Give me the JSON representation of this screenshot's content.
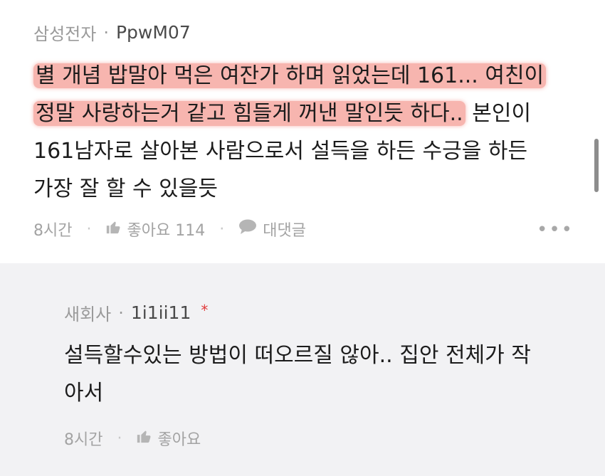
{
  "comment": {
    "company": "삼성전자",
    "separator": "·",
    "username": "PpwM07",
    "lines": [
      {
        "highlight": "별 개념 밥말아 먹은 여잔가 하며 읽었는데 161... 여친이",
        "rest": ""
      },
      {
        "highlight": "정말 사랑하는거 같고 힘들게 꺼낸 말인듯 하다..",
        "rest": " 본인이"
      },
      {
        "highlight": "",
        "rest": "161남자로 살아본 사람으로서 설득을 하든 수긍을 하든"
      },
      {
        "highlight": "",
        "rest": "가장 잘 할 수 있을듯"
      }
    ],
    "time": "8시간",
    "like_label": "좋아요 114",
    "reply_label": "대댓글",
    "more": "•••",
    "dot": "·"
  },
  "reply": {
    "company": "새회사",
    "separator": "·",
    "username": "1i1ii11",
    "star": "*",
    "lines": [
      "설득할수있는 방법이 떠오르질 않아.. 집안 전체가 작",
      "아서"
    ],
    "time": "8시간",
    "like_label": "좋아요",
    "dot": "·"
  },
  "icons": {
    "like": "thumbs-up-icon",
    "reply": "speech-bubble-icon",
    "more": "more-dots-icon"
  },
  "colors": {
    "highlight": "#f0786e",
    "star": "#e03a3a",
    "reply_bg": "#f2f2f4",
    "meta": "#9a9a9a"
  }
}
